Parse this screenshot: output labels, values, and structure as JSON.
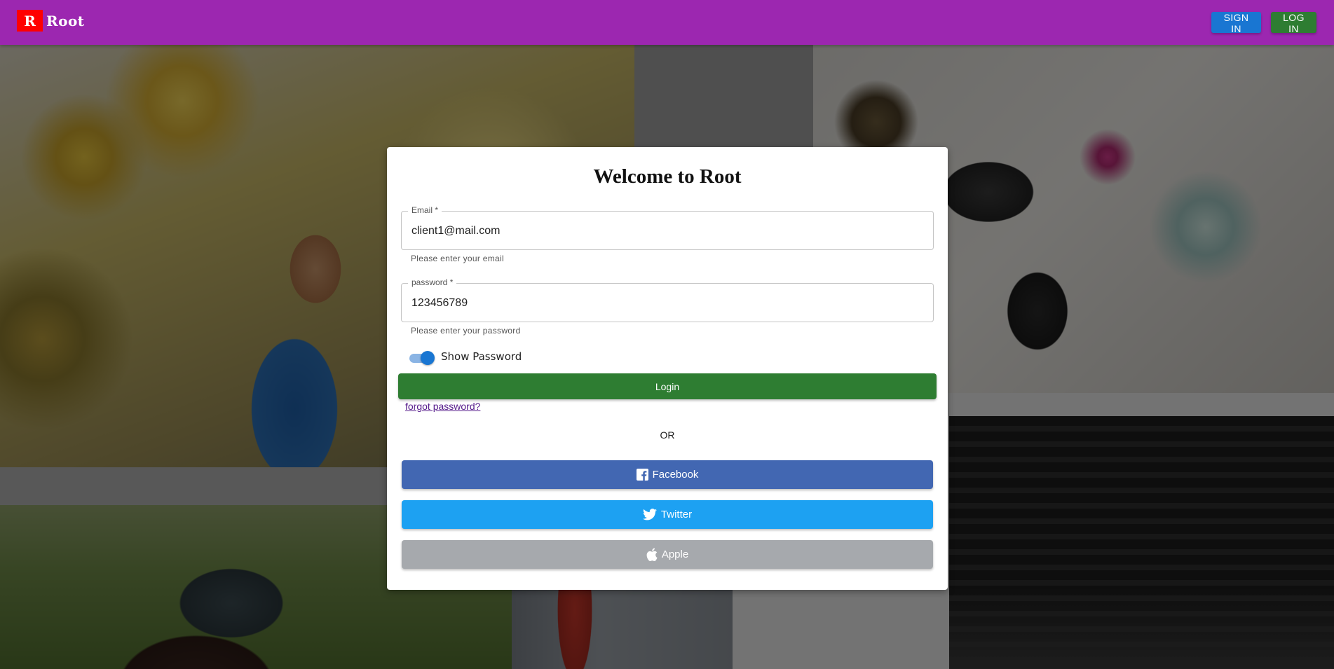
{
  "app": {
    "logo_letter": "R",
    "logo_text": "Root"
  },
  "nav": {
    "sign_in": "SIGN IN",
    "log_in": "LOG IN"
  },
  "card": {
    "title": "Welcome to Root",
    "email": {
      "label": "Email *",
      "value": "client1@mail.com",
      "helper": "Please enter your email"
    },
    "password": {
      "label": "password *",
      "value": "123456789",
      "helper": "Please enter your password"
    },
    "show_password": {
      "label": "Show Password",
      "checked": true
    },
    "login_button": "Login",
    "forgot_link": "forgot password?",
    "or_text": "OR",
    "social": {
      "facebook": "Facebook",
      "twitter": "Twitter",
      "apple": "Apple"
    }
  },
  "colors": {
    "appbar": "#9c27b0",
    "sign_in_button": "#1976d2",
    "log_in_button": "#2e7d32",
    "login_button": "#2e7d32",
    "facebook": "#4267b2",
    "twitter": "#1da1f2",
    "apple": "#a6a9ad",
    "switch_on": "#1976d2"
  },
  "icons": {
    "facebook": "facebook-icon",
    "twitter": "twitter-icon",
    "apple": "apple-icon"
  }
}
